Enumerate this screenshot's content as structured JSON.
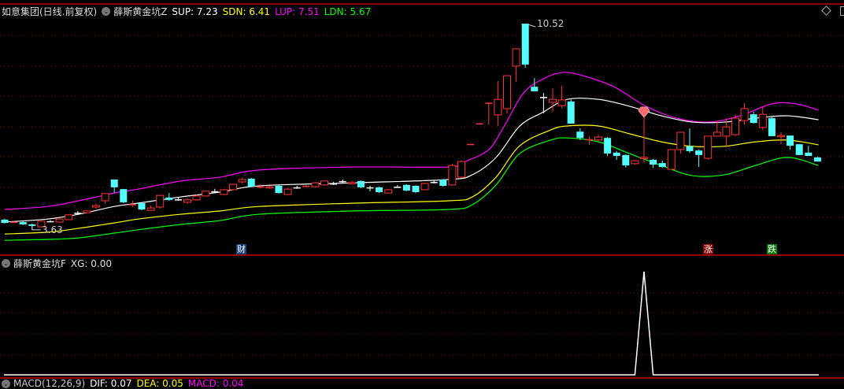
{
  "main_panel": {
    "stock_title": "如意集团(日线.前复权)",
    "indicator_name": "薛斯黄金坑Z",
    "values": [
      {
        "label": "SUP: 7.23",
        "color": "#ffffff"
      },
      {
        "label": "SDN: 6.41",
        "color": "#ffff00"
      },
      {
        "label": "LUP: 7.51",
        "color": "#ff00ff"
      },
      {
        "label": "LDN: 5.67",
        "color": "#00ff00"
      }
    ],
    "high_label": "10.52",
    "low_label": "3.63",
    "markers": [
      {
        "text": "财",
        "index": 26,
        "color": "#1a3f7a"
      },
      {
        "text": "涨",
        "index": 77,
        "color": "#8b0000"
      },
      {
        "text": "跌",
        "index": 84,
        "color": "#0a7a0a"
      }
    ],
    "diamond_signal_index": 70
  },
  "sub_panel": {
    "indicator_name": "薛斯黄金坑F",
    "value_label": "XG: 0.00"
  },
  "macd_panel": {
    "name": "MACD(12,26,9)",
    "dif": "DIF: 0.07",
    "dea": "DEA: 0.05",
    "macd": "MACD: 0.04"
  },
  "colors": {
    "up": "#ff3333",
    "down": "#54ffff",
    "grid": "#8b0000",
    "sup": "#ffffff",
    "sdn": "#ffff00",
    "lup": "#ff00ff",
    "ldn": "#00ff00"
  },
  "chart_data": {
    "type": "candlestick",
    "candles_ohlc": [
      [
        3.97,
        3.86,
        4.0,
        3.84
      ],
      [
        3.88,
        3.9,
        3.91,
        3.87
      ],
      [
        3.89,
        3.81,
        3.91,
        3.79
      ],
      [
        3.81,
        3.76,
        3.84,
        3.63
      ],
      [
        3.73,
        3.92,
        3.94,
        3.71
      ],
      [
        3.92,
        3.92,
        3.95,
        3.89
      ],
      [
        3.89,
        3.99,
        4.01,
        3.87
      ],
      [
        3.97,
        4.13,
        4.15,
        3.95
      ],
      [
        4.2,
        4.2,
        4.26,
        4.15
      ],
      [
        4.2,
        4.26,
        4.28,
        4.18
      ],
      [
        4.39,
        4.44,
        4.5,
        4.34
      ],
      [
        4.6,
        4.84,
        4.86,
        4.5
      ],
      [
        5.31,
        5.05,
        5.31,
        4.86
      ],
      [
        4.99,
        4.55,
        5.0,
        4.52
      ],
      [
        4.47,
        4.49,
        4.6,
        4.39
      ],
      [
        4.52,
        4.31,
        4.55,
        4.28
      ],
      [
        4.28,
        4.36,
        4.44,
        4.26
      ],
      [
        4.39,
        4.78,
        4.8,
        4.34
      ],
      [
        4.71,
        4.63,
        4.86,
        4.6
      ],
      [
        4.65,
        4.65,
        4.71,
        4.6
      ],
      [
        4.55,
        4.63,
        4.68,
        4.5
      ],
      [
        4.63,
        4.76,
        4.81,
        4.6
      ],
      [
        4.76,
        4.92,
        4.92,
        4.74
      ],
      [
        4.92,
        4.9,
        5.0,
        4.86
      ],
      [
        4.81,
        4.97,
        4.99,
        4.79
      ],
      [
        4.97,
        5.15,
        5.17,
        4.95
      ],
      [
        5.23,
        5.31,
        5.36,
        5.18
      ],
      [
        5.34,
        5.07,
        5.36,
        5.05
      ],
      [
        5.06,
        5.08,
        5.15,
        5.02
      ],
      [
        5.03,
        5.07,
        5.1,
        5.0
      ],
      [
        5.1,
        4.86,
        5.12,
        4.84
      ],
      [
        4.81,
        4.99,
        5.02,
        4.79
      ],
      [
        5.05,
        5.05,
        5.1,
        5.0
      ],
      [
        5.08,
        5.1,
        5.13,
        5.05
      ],
      [
        5.07,
        5.2,
        5.22,
        5.05
      ],
      [
        5.13,
        5.26,
        5.28,
        5.1
      ],
      [
        5.18,
        5.18,
        5.23,
        5.13
      ],
      [
        5.26,
        5.26,
        5.31,
        5.2
      ],
      [
        5.18,
        5.21,
        5.26,
        5.15
      ],
      [
        5.26,
        5.05,
        5.28,
        5.02
      ],
      [
        5.05,
        5.05,
        5.1,
        4.92
      ],
      [
        5.05,
        4.89,
        5.07,
        4.86
      ],
      [
        4.86,
        4.97,
        4.99,
        4.84
      ],
      [
        5.07,
        5.07,
        5.12,
        5.03
      ],
      [
        5.13,
        4.94,
        5.15,
        4.92
      ],
      [
        5.1,
        4.89,
        5.12,
        4.86
      ],
      [
        4.97,
        5.18,
        5.2,
        4.95
      ],
      [
        5.23,
        5.23,
        5.28,
        5.18
      ],
      [
        5.31,
        5.1,
        5.33,
        5.07
      ],
      [
        5.13,
        5.78,
        5.84,
        5.1
      ],
      [
        5.39,
        5.91,
        5.94,
        5.36
      ],
      [
        6.49,
        6.5,
        6.5,
        6.49
      ],
      [
        7.18,
        7.19,
        7.19,
        7.18
      ],
      [
        7.86,
        7.88,
        7.88,
        7.15
      ],
      [
        7.47,
        7.99,
        8.6,
        7.1
      ],
      [
        7.68,
        8.78,
        8.78,
        7.52
      ],
      [
        9.1,
        9.68,
        9.68,
        8.57
      ],
      [
        10.52,
        9.15,
        10.52,
        9.05
      ],
      [
        8.41,
        8.26,
        8.7,
        8.26
      ],
      [
        8.07,
        8.05,
        8.2,
        7.52
      ],
      [
        7.89,
        7.99,
        8.36,
        7.57
      ],
      [
        7.78,
        7.97,
        8.44,
        7.7
      ],
      [
        7.92,
        7.18,
        7.99,
        7.18
      ],
      [
        6.91,
        6.7,
        7.02,
        6.63
      ],
      [
        6.65,
        6.66,
        6.76,
        6.47
      ],
      [
        6.63,
        6.73,
        6.81,
        6.6
      ],
      [
        6.7,
        6.18,
        6.73,
        6.1
      ],
      [
        6.21,
        6.1,
        6.26,
        5.97
      ],
      [
        6.13,
        5.78,
        6.15,
        5.71
      ],
      [
        5.84,
        5.94,
        5.97,
        5.81
      ],
      [
        6.02,
        6.05,
        7.63,
        5.89
      ],
      [
        5.97,
        5.81,
        6.0,
        5.7
      ],
      [
        5.86,
        5.73,
        5.94,
        5.7
      ],
      [
        5.65,
        6.31,
        6.31,
        5.65
      ],
      [
        6.31,
        6.89,
        6.89,
        6.18
      ],
      [
        6.42,
        6.26,
        7.02,
        6.2
      ],
      [
        6.28,
        6.13,
        6.31,
        5.73
      ],
      [
        6.02,
        6.76,
        6.76,
        5.97
      ],
      [
        6.76,
        6.89,
        7.26,
        6.76
      ],
      [
        6.76,
        7.07,
        7.36,
        6.39
      ],
      [
        6.81,
        7.36,
        7.49,
        6.76
      ],
      [
        7.28,
        7.68,
        7.86,
        7.13
      ],
      [
        7.49,
        7.2,
        7.57,
        7.18
      ],
      [
        7.05,
        7.49,
        7.73,
        6.97
      ],
      [
        7.36,
        6.76,
        7.39,
        6.76
      ],
      [
        6.74,
        6.78,
        6.89,
        6.49
      ],
      [
        6.78,
        6.44,
        6.78,
        6.31
      ],
      [
        6.49,
        6.13,
        6.49,
        6.13
      ],
      [
        6.21,
        6.1,
        6.44,
        6.1
      ],
      [
        6.05,
        5.91,
        6.08,
        5.91
      ]
    ],
    "lines": {
      "LUP": [
        [
          0,
          4.31
        ],
        [
          4.7,
          4.41
        ],
        [
          8.1,
          4.6
        ],
        [
          12,
          4.86
        ],
        [
          14.6,
          4.99
        ],
        [
          19.3,
          5.26
        ],
        [
          23.6,
          5.39
        ],
        [
          27.9,
          5.63
        ],
        [
          38.3,
          5.73
        ],
        [
          48.6,
          5.73
        ],
        [
          50.4,
          5.91
        ],
        [
          53,
          6.31
        ],
        [
          54.7,
          7.1
        ],
        [
          56.8,
          8.2
        ],
        [
          59,
          8.68
        ],
        [
          61.1,
          8.89
        ],
        [
          63.3,
          8.78
        ],
        [
          66.7,
          8.41
        ],
        [
          70.2,
          7.76
        ],
        [
          73.6,
          7.36
        ],
        [
          77.1,
          7.23
        ],
        [
          80.5,
          7.44
        ],
        [
          84,
          7.84
        ],
        [
          86.6,
          7.84
        ],
        [
          89.1,
          7.63
        ]
      ],
      "SUP": [
        [
          0,
          3.89
        ],
        [
          4.7,
          3.99
        ],
        [
          8.1,
          4.15
        ],
        [
          12,
          4.41
        ],
        [
          14.6,
          4.52
        ],
        [
          19.3,
          4.73
        ],
        [
          23.6,
          4.89
        ],
        [
          27.9,
          5.1
        ],
        [
          38.3,
          5.2
        ],
        [
          48.6,
          5.31
        ],
        [
          51.2,
          5.47
        ],
        [
          53.8,
          6.05
        ],
        [
          56.4,
          7.1
        ],
        [
          59,
          7.57
        ],
        [
          61.6,
          7.99
        ],
        [
          65,
          7.99
        ],
        [
          68.4,
          7.76
        ],
        [
          71.9,
          7.44
        ],
        [
          75.3,
          7.23
        ],
        [
          78.8,
          7.23
        ],
        [
          82.2,
          7.36
        ],
        [
          85.7,
          7.44
        ],
        [
          89.1,
          7.31
        ]
      ],
      "SDN": [
        [
          0,
          3.49
        ],
        [
          4.7,
          3.55
        ],
        [
          8.1,
          3.68
        ],
        [
          12,
          3.86
        ],
        [
          14.6,
          3.99
        ],
        [
          19.3,
          4.15
        ],
        [
          23.6,
          4.26
        ],
        [
          27.9,
          4.41
        ],
        [
          38.3,
          4.52
        ],
        [
          48.6,
          4.6
        ],
        [
          51.2,
          4.73
        ],
        [
          53.8,
          5.39
        ],
        [
          56.4,
          6.44
        ],
        [
          59.8,
          6.97
        ],
        [
          61.6,
          7.1
        ],
        [
          65,
          7.1
        ],
        [
          68.4,
          6.84
        ],
        [
          71.9,
          6.57
        ],
        [
          75.3,
          6.42
        ],
        [
          78.8,
          6.42
        ],
        [
          82.2,
          6.57
        ],
        [
          85.7,
          6.63
        ],
        [
          89.1,
          6.47
        ]
      ],
      "LDN": [
        [
          0,
          3.28
        ],
        [
          4.7,
          3.31
        ],
        [
          8.1,
          3.36
        ],
        [
          12,
          3.52
        ],
        [
          14.6,
          3.63
        ],
        [
          19.3,
          3.81
        ],
        [
          23.6,
          3.94
        ],
        [
          27.9,
          4.15
        ],
        [
          38.3,
          4.26
        ],
        [
          48.6,
          4.31
        ],
        [
          51.2,
          4.47
        ],
        [
          53.8,
          5.13
        ],
        [
          56.4,
          6.18
        ],
        [
          59.8,
          6.63
        ],
        [
          61.6,
          6.7
        ],
        [
          65,
          6.57
        ],
        [
          68.4,
          6.18
        ],
        [
          71.9,
          5.78
        ],
        [
          75.3,
          5.44
        ],
        [
          78.8,
          5.47
        ],
        [
          82.2,
          5.78
        ],
        [
          85.7,
          6.05
        ],
        [
          89.1,
          5.78
        ]
      ]
    },
    "xg_signal": {
      "index": 70,
      "value": 1,
      "others": 0
    }
  }
}
